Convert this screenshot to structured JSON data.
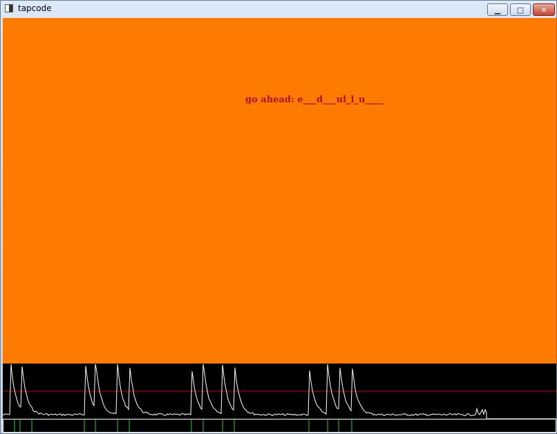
{
  "window": {
    "title": "tapcode",
    "controls": {
      "minimize": "▁",
      "maximize": "□",
      "close": "✕"
    }
  },
  "canvas": {
    "background": "#ff7a00",
    "prompt_label": "go ahead: e___d___ul_l_u____"
  },
  "scope": {
    "background": "#000000",
    "signal_color": "#ffffff",
    "threshold_color": "#cc0000",
    "tap_marker_color": "#2ecc40",
    "tap_count": 20
  }
}
